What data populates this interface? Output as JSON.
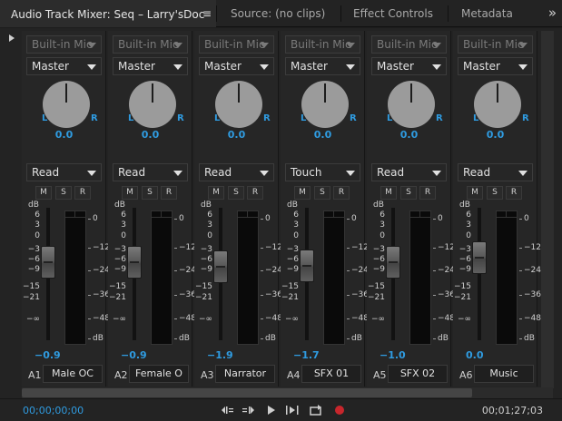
{
  "tabs": [
    {
      "label": "Audio Track Mixer: Seq – Larry'sDoc",
      "active": true
    },
    {
      "label": "Source: (no clips)",
      "active": false
    },
    {
      "label": "Effect Controls",
      "active": false
    },
    {
      "label": "Metadata",
      "active": false
    }
  ],
  "tab_menu_glyph": "≡",
  "overflow_glyph": "»",
  "db_header": "dB",
  "left_scale": [
    "6",
    "3",
    "0",
    "−3",
    "−6",
    "−9",
    "−15",
    "−21",
    "−∞"
  ],
  "right_scale": [
    "0",
    "−12",
    "−24",
    "−36",
    "−48",
    "dB"
  ],
  "msr": [
    "M",
    "S",
    "R"
  ],
  "pan_left": "L",
  "pan_right": "R",
  "tracks": [
    {
      "input": "Built-in Mic",
      "output": "Master",
      "pan": "0.0",
      "automation": "Read",
      "volume": "−0.9",
      "id": "A1",
      "name": "Male OC",
      "fader_db": -0.9
    },
    {
      "input": "Built-in Mic",
      "output": "Master",
      "pan": "0.0",
      "automation": "Read",
      "volume": "−0.9",
      "id": "A2",
      "name": "Female O",
      "fader_db": -0.9
    },
    {
      "input": "Built-in Mic",
      "output": "Master",
      "pan": "0.0",
      "automation": "Read",
      "volume": "−1.9",
      "id": "A3",
      "name": "Narrator",
      "fader_db": -1.9
    },
    {
      "input": "Built-in Mic",
      "output": "Master",
      "pan": "0.0",
      "automation": "Touch",
      "volume": "−1.7",
      "id": "A4",
      "name": "SFX 01",
      "fader_db": -1.7
    },
    {
      "input": "Built-in Mic",
      "output": "Master",
      "pan": "0.0",
      "automation": "Read",
      "volume": "−1.0",
      "id": "A5",
      "name": "SFX 02",
      "fader_db": -1.0
    },
    {
      "input": "Built-in Mic",
      "output": "Master",
      "pan": "0.0",
      "automation": "Read",
      "volume": "0.0",
      "id": "A6",
      "name": "Music",
      "fader_db": 0.0
    }
  ],
  "timecode_current": "00;00;00;00",
  "timecode_duration": "00;01;27;03",
  "colors": {
    "accent": "#2f9be0",
    "panel": "#232323",
    "record": "#c8262c"
  }
}
